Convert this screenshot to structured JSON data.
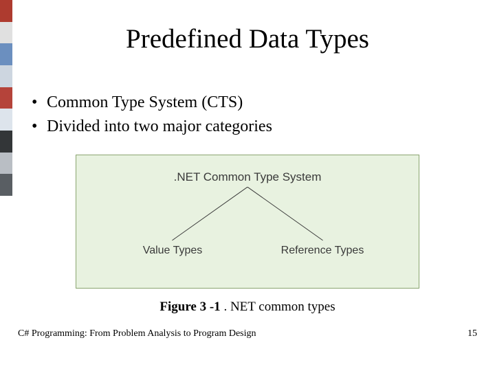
{
  "slide": {
    "title": "Predefined Data Types",
    "bullets": [
      "Common Type System (CTS)",
      "Divided into two major categories"
    ],
    "caption_label": "Figure 3 -1 ",
    "caption_text": ". NET common types",
    "footer_text": "C# Programming: From Problem Analysis to Program Design",
    "page_number": "15"
  },
  "chart_data": {
    "type": "diagram",
    "title": ".NET Common Type System",
    "root": ".NET Common Type System",
    "children": [
      "Value Types",
      "Reference Types"
    ]
  }
}
